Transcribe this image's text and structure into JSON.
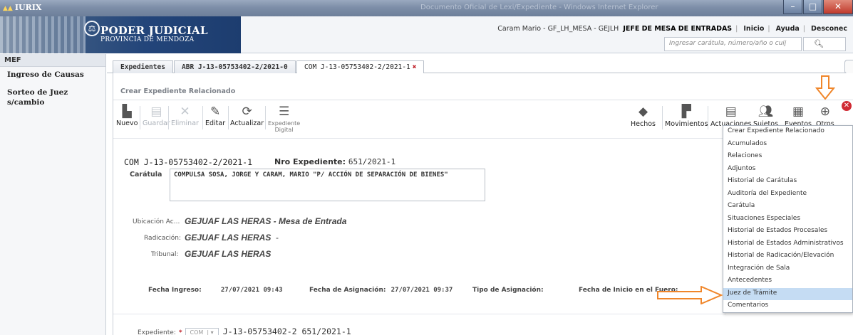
{
  "window": {
    "app_name": "IURIX",
    "title": "Documento Oficial de Lexi/Expediente - Windows Internet Explorer",
    "btn_min": "–",
    "btn_max": "□",
    "btn_close": "✕"
  },
  "header": {
    "brand_line1": "PODER JUDICIAL",
    "brand_line2": "PROVINCIA DE MENDOZA",
    "user_text": "Caram Mario - GF_LH_MESA - GEJLH",
    "role_text": "JEFE DE MESA DE ENTRADAS",
    "links": [
      "Inicio",
      "Ayuda",
      "Desconec"
    ],
    "search_placeholder": "Ingresar carátula, número/año o cuij",
    "search_icon": "search-icon"
  },
  "sidebar": {
    "title": "MEF",
    "items": [
      "Ingreso de Causas",
      "Sorteo de Juez s/cambio"
    ]
  },
  "tabs": [
    {
      "label": "Expedientes"
    },
    {
      "label": "ABR J-13-05753402-2/2021-0"
    },
    {
      "label": "COM J-13-05753402-2/2021-1",
      "close": "✖"
    }
  ],
  "panel": {
    "subtitle": "Crear Expediente Relacionado",
    "toolbar": [
      {
        "label": "Nuevo",
        "icon": "document-icon"
      },
      {
        "label": "Guardar",
        "icon": "save-icon"
      },
      {
        "label": "Eliminar",
        "icon": "delete-icon"
      },
      {
        "label": "Editar",
        "icon": "edit-icon"
      },
      {
        "label": "Actualizar",
        "icon": "refresh-icon"
      },
      {
        "label": "Expediente",
        "label2": "Digital",
        "icon": "digital-file-icon"
      }
    ],
    "right_toolbar": [
      {
        "label": "Hechos",
        "icon": "diamond-icon"
      },
      {
        "label": "Movimientos",
        "icon": "movements-icon"
      },
      {
        "label": "Actuaciones",
        "icon": "document-lines-icon"
      },
      {
        "label": "Sujetos",
        "icon": "users-icon"
      },
      {
        "label": "Eventos",
        "icon": "calendar-icon"
      },
      {
        "label": "Otros",
        "icon": "plus-circle-icon"
      }
    ],
    "exp_number": "COM J-13-05753402-2/2021-1",
    "nro_label": "Nro Expediente:",
    "nro_value": "651/2021-1",
    "caratula_label": "Carátula",
    "caratula_value": "COMPULSA SOSA, JORGE  Y CARAM, MARIO \"P/  ACCIÓN DE SEPARACIÓN DE BIENES\"",
    "ubicacion_label": "Ubicación Ac...",
    "ubicacion_value": "GEJUAF LAS HERAS - Mesa de Entrada",
    "radicacion_label": "Radicación:",
    "radicacion_value": "GEJUAF LAS HERAS",
    "radicacion_dash": "-",
    "tribunal_label": "Tribunal:",
    "tribunal_value": "GEJUAF LAS HERAS",
    "fecha_ingreso_label": "Fecha Ingreso:",
    "fecha_ingreso_value": "27/07/2021 09:43",
    "fecha_asig_label": "Fecha de Asignación:",
    "fecha_asig_value": "27/07/2021 09:37",
    "tipo_asig_label": "Tipo de Asignación:",
    "fecha_inicio_label": "Fecha de Inicio en el Fuero:",
    "expediente_label": "Expediente:",
    "expediente_req": "*",
    "expediente_combo": "COM",
    "expediente_combo_arrow": "▾",
    "expediente_number": "J-13-05753402-2 651/2021-1"
  },
  "dropdown": {
    "items": [
      "Crear Expediente Relacionado",
      "Acumulados",
      "Relaciones",
      "Adjuntos",
      "Historial de Carátulas",
      "Auditoría del Expediente",
      "Carátula",
      "Situaciones Especiales",
      "Historial de Estados Procesales",
      "Historial de Estados Administrativos",
      "Historial de Radicación/Elevación",
      "Integración de Sala",
      "Antecedentes",
      "Juez de Trámite",
      "Comentarios"
    ],
    "highlighted": "Juez de Trámite"
  },
  "colors": {
    "accent_orange": "#f0862a",
    "highlight": "#c5dcf3",
    "close_red": "#d02b34"
  }
}
